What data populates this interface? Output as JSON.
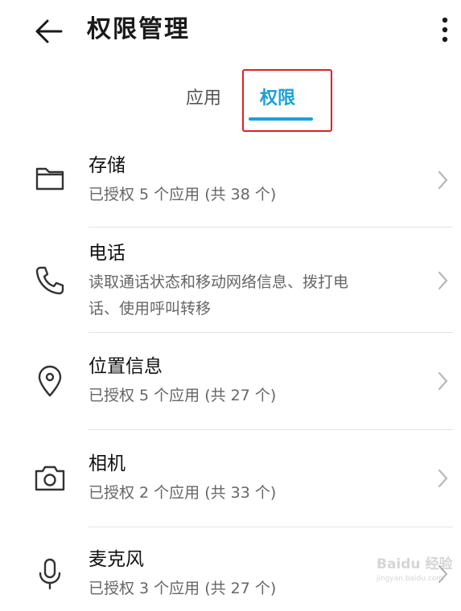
{
  "header": {
    "title": "权限管理"
  },
  "tabs": [
    {
      "label": "应用",
      "active": false
    },
    {
      "label": "权限",
      "active": true
    }
  ],
  "colors": {
    "accent": "#1aa0d8",
    "highlight_box": "#e02020"
  },
  "permissions": [
    {
      "title": "存储",
      "subtitle": "已授权 5 个应用 (共 38 个)",
      "icon": "folder-icon"
    },
    {
      "title": "电话",
      "subtitle_line1": "读取通话状态和移动网络信息、拨打电",
      "subtitle_line2": "话、使用呼叫转移",
      "icon": "phone-icon"
    },
    {
      "title": "位置信息",
      "subtitle": "已授权 5 个应用 (共 27 个)",
      "icon": "location-pin-icon"
    },
    {
      "title": "相机",
      "subtitle": "已授权 2 个应用 (共 33 个)",
      "icon": "camera-icon"
    },
    {
      "title": "麦克风",
      "subtitle": "已授权 3 个应用 (共 27 个)",
      "icon": "microphone-icon"
    }
  ],
  "watermark": {
    "text": "Baidu 经验",
    "subtext": "jingyan.baidu.com"
  }
}
